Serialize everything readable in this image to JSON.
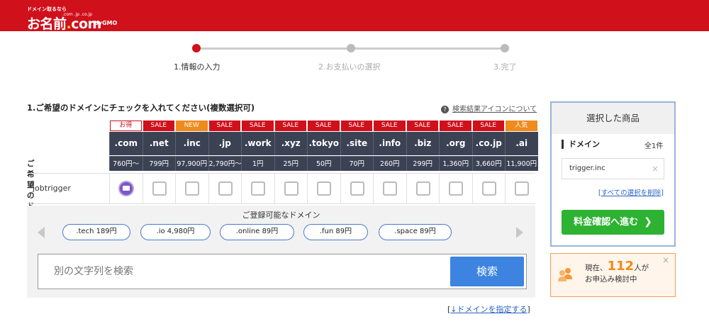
{
  "header": {
    "logo_tagline": "ドメイン取るなら",
    "logo_tlds": ".com .jp .co.jp",
    "logo_text": "お名前",
    "logo_dot": ".",
    "logo_com": "com",
    "logo_gmo": "byGMO"
  },
  "steps": [
    {
      "label": "1.情報の入力",
      "active": true
    },
    {
      "label": "2.お支払いの選択",
      "active": false
    },
    {
      "label": "3.完了",
      "active": false
    }
  ],
  "section_title": "1.ご希望のドメインにチェックを入れてください(複数選択可)",
  "help": {
    "icon": "question-icon",
    "q": "?",
    "link": "検索結果アイコンについて"
  },
  "table": {
    "row_header": "ご希望のドメイン",
    "columns": [
      {
        "badge": "お得",
        "badge_style": "outline",
        "tld": ".com",
        "price": "760円〜"
      },
      {
        "badge": "SALE",
        "badge_style": "red",
        "tld": ".net",
        "price": "799円"
      },
      {
        "badge": "NEW",
        "badge_style": "orange",
        "tld": ".inc",
        "price": "97,900円"
      },
      {
        "badge": "SALE",
        "badge_style": "red",
        "tld": ".jp",
        "price": "2,790円〜"
      },
      {
        "badge": "SALE",
        "badge_style": "red",
        "tld": ".work",
        "price": "1円"
      },
      {
        "badge": "SALE",
        "badge_style": "red",
        "tld": ".xyz",
        "price": "25円"
      },
      {
        "badge": "SALE",
        "badge_style": "red",
        "tld": ".tokyo",
        "price": "50円"
      },
      {
        "badge": "SALE",
        "badge_style": "red",
        "tld": ".site",
        "price": "70円"
      },
      {
        "badge": "SALE",
        "badge_style": "red",
        "tld": ".info",
        "price": "260円"
      },
      {
        "badge": "SALE",
        "badge_style": "red",
        "tld": ".biz",
        "price": "299円"
      },
      {
        "badge": "SALE",
        "badge_style": "red",
        "tld": ".org",
        "price": "1,360円"
      },
      {
        "badge": "SALE",
        "badge_style": "red",
        "tld": ".co.jp",
        "price": "3,660円"
      },
      {
        "badge": "人気",
        "badge_style": "orange",
        "tld": ".ai",
        "price": "11,900円"
      }
    ],
    "rows": [
      {
        "name": "jobtrigger",
        "first_cell": "mail-icon"
      }
    ]
  },
  "suggest": {
    "title": "ご登録可能なドメイン",
    "items": [
      ".tech  189円",
      ".io  4,980円",
      ".online  89円",
      ".fun  89円",
      ".space  89円"
    ]
  },
  "search": {
    "placeholder": "別の文字列を検索",
    "button": "検索"
  },
  "specify": {
    "open": "[",
    "link": "↓ドメインを指定する",
    "close": "]"
  },
  "cart": {
    "title": "選択した商品",
    "domain_label": "ドメイン",
    "count": "全1件",
    "selected": "trigger.inc",
    "remove": "×",
    "clear_open": "[",
    "clear_link": "すべての選択を削除",
    "clear_close": "]",
    "proceed": "料金確認へ進む",
    "proceed_chev": "❯"
  },
  "promo": {
    "close": "×",
    "prefix": "現在、",
    "count": "112",
    "suffix": "人が",
    "line2": "お申込み検討中"
  },
  "colors": {
    "brand_red": "#d0101b",
    "table_header": "#3b4254",
    "go_green": "#2db232",
    "search_blue": "#3c84e0"
  }
}
